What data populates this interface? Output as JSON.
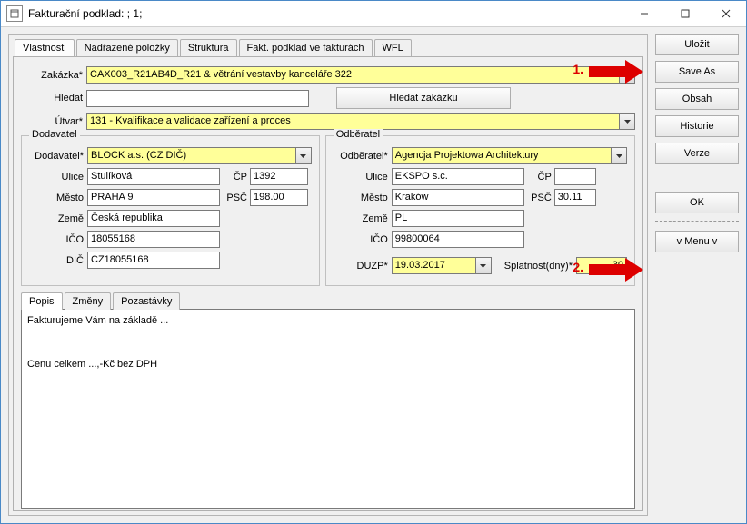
{
  "title": "Fakturační podklad: ; 1;",
  "tabs": [
    "Vlastnosti",
    "Nadřazené položky",
    "Struktura",
    "Fakt. podklad ve fakturách",
    "WFL"
  ],
  "side_buttons": {
    "ulozit": "Uložit",
    "save_as": "Save As",
    "obsah": "Obsah",
    "historie": "Historie",
    "verze": "Verze",
    "ok": "OK",
    "menu": "v  Menu  v"
  },
  "form": {
    "zakazka_label": "Zakázka*",
    "zakazka": "CAX003_R21AB4D_R21 & větrání vestavby kanceláře 322",
    "hledat_label": "Hledat",
    "hledat": "",
    "hledat_btn": "Hledat zakázku",
    "utvar_label": "Útvar*",
    "utvar": "131 - Kvalifikace a validace zařízení a proces"
  },
  "dodavatel": {
    "legend": "Dodavatel",
    "dodavatel_label": "Dodavatel*",
    "dodavatel": "BLOCK a.s. (CZ DIČ)",
    "ulice_label": "Ulice",
    "ulice": "Stulíková",
    "cp_label": "ČP",
    "cp": "1392",
    "mesto_label": "Město",
    "mesto": "PRAHA 9",
    "psc_label": "PSČ",
    "psc": "198.00",
    "zeme_label": "Země",
    "zeme": "Česká republika",
    "ico_label": "IČO",
    "ico": "18055168",
    "dic_label": "DIČ",
    "dic": "CZ18055168"
  },
  "odberatel": {
    "legend": "Odběratel",
    "odberatel_label": "Odběratel*",
    "odberatel": "Agencja Projektowa Architektury",
    "ulice_label": "Ulice",
    "ulice": "EKSPO s.c.",
    "cp_label": "ČP",
    "cp": "",
    "mesto_label": "Město",
    "mesto": "Kraków",
    "psc_label": "PSČ",
    "psc": "30.11",
    "zeme_label": "Země",
    "zeme": "PL",
    "ico_label": "IČO",
    "ico": "99800064",
    "duzp_label": "DUZP*",
    "duzp": "19.03.2017",
    "splatnost_label": "Splatnost(dny)*",
    "splatnost": "30"
  },
  "inner_tabs": [
    "Popis",
    "Změny",
    "Pozastávky"
  ],
  "memo": "Fakturujeme Vám na základě ...\n\n\nCenu celkem ...,-Kč bez DPH",
  "anno": {
    "one": "1.",
    "two": "2."
  }
}
